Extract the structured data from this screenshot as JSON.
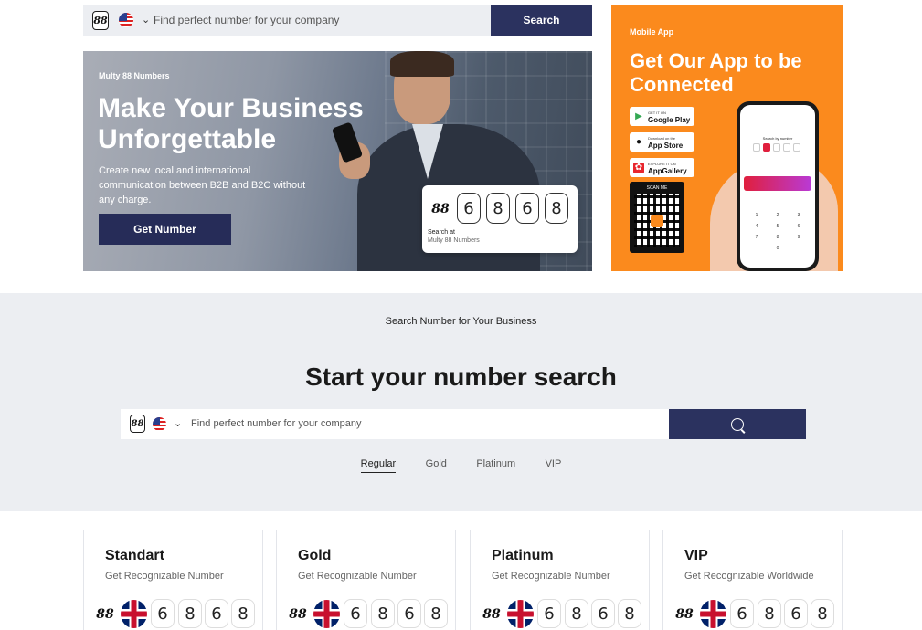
{
  "top_search": {
    "logo": "88",
    "placeholder": "Find perfect number for your company",
    "button_label": "Search"
  },
  "hero": {
    "eyebrow": "Multy 88 Numbers",
    "title": "Make Your Business Unforgettable",
    "description": "Create new local and international communication between B2B and B2C without any charge.",
    "button_label": "Get Number",
    "card": {
      "logo": "88",
      "digits": [
        "6",
        "8",
        "6",
        "8"
      ],
      "caption_line1": "Search at",
      "caption_line2": "Multy 88 Numbers"
    }
  },
  "app_promo": {
    "eyebrow": "Mobile App",
    "title": "Get Our App to be Connected",
    "stores": [
      {
        "small": "GET IT ON",
        "big": "Google Play",
        "icon": "google-play-icon"
      },
      {
        "small": "Download on the",
        "big": "App Store",
        "icon": "apple-icon"
      },
      {
        "small": "EXPLORE IT ON",
        "big": "AppGallery",
        "icon": "huawei-icon"
      }
    ],
    "qr_label": "SCAN ME",
    "phone_search_label": "Search by number",
    "accent_color": "#fb8a1d"
  },
  "search_section": {
    "eyebrow": "Search Number for Your Business",
    "title": "Start your number search",
    "logo": "88",
    "placeholder": "Find perfect number for your company",
    "tabs": [
      {
        "label": "Regular",
        "active": true
      },
      {
        "label": "Gold",
        "active": false
      },
      {
        "label": "Platinum",
        "active": false
      },
      {
        "label": "VIP",
        "active": false
      }
    ]
  },
  "cards": [
    {
      "title": "Standart",
      "subtitle": "Get Recognizable Number",
      "logo": "88",
      "digits": [
        "6",
        "8",
        "6",
        "8"
      ]
    },
    {
      "title": "Gold",
      "subtitle": "Get Recognizable Number",
      "logo": "88",
      "digits": [
        "6",
        "8",
        "6",
        "8"
      ]
    },
    {
      "title": "Platinum",
      "subtitle": "Get Recognizable Number",
      "logo": "88",
      "digits": [
        "6",
        "8",
        "6",
        "8"
      ]
    },
    {
      "title": "VIP",
      "subtitle": "Get Recognizable Worldwide",
      "logo": "88",
      "digits": [
        "6",
        "8",
        "6",
        "8"
      ]
    }
  ],
  "colors": {
    "navy": "#2b325f",
    "hero_button": "#262c58",
    "section_bg": "#eceef2"
  }
}
